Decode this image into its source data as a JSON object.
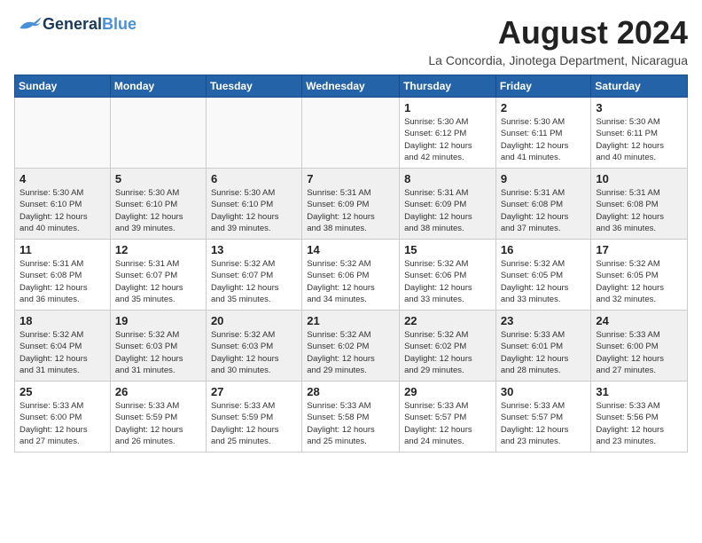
{
  "logo": {
    "part1": "General",
    "part2": "Blue"
  },
  "title": {
    "month_year": "August 2024",
    "location": "La Concordia, Jinotega Department, Nicaragua"
  },
  "weekdays": [
    "Sunday",
    "Monday",
    "Tuesday",
    "Wednesday",
    "Thursday",
    "Friday",
    "Saturday"
  ],
  "weeks": [
    [
      {
        "day": "",
        "info": ""
      },
      {
        "day": "",
        "info": ""
      },
      {
        "day": "",
        "info": ""
      },
      {
        "day": "",
        "info": ""
      },
      {
        "day": "1",
        "info": "Sunrise: 5:30 AM\nSunset: 6:12 PM\nDaylight: 12 hours\nand 42 minutes."
      },
      {
        "day": "2",
        "info": "Sunrise: 5:30 AM\nSunset: 6:11 PM\nDaylight: 12 hours\nand 41 minutes."
      },
      {
        "day": "3",
        "info": "Sunrise: 5:30 AM\nSunset: 6:11 PM\nDaylight: 12 hours\nand 40 minutes."
      }
    ],
    [
      {
        "day": "4",
        "info": "Sunrise: 5:30 AM\nSunset: 6:10 PM\nDaylight: 12 hours\nand 40 minutes."
      },
      {
        "day": "5",
        "info": "Sunrise: 5:30 AM\nSunset: 6:10 PM\nDaylight: 12 hours\nand 39 minutes."
      },
      {
        "day": "6",
        "info": "Sunrise: 5:30 AM\nSunset: 6:10 PM\nDaylight: 12 hours\nand 39 minutes."
      },
      {
        "day": "7",
        "info": "Sunrise: 5:31 AM\nSunset: 6:09 PM\nDaylight: 12 hours\nand 38 minutes."
      },
      {
        "day": "8",
        "info": "Sunrise: 5:31 AM\nSunset: 6:09 PM\nDaylight: 12 hours\nand 38 minutes."
      },
      {
        "day": "9",
        "info": "Sunrise: 5:31 AM\nSunset: 6:08 PM\nDaylight: 12 hours\nand 37 minutes."
      },
      {
        "day": "10",
        "info": "Sunrise: 5:31 AM\nSunset: 6:08 PM\nDaylight: 12 hours\nand 36 minutes."
      }
    ],
    [
      {
        "day": "11",
        "info": "Sunrise: 5:31 AM\nSunset: 6:08 PM\nDaylight: 12 hours\nand 36 minutes."
      },
      {
        "day": "12",
        "info": "Sunrise: 5:31 AM\nSunset: 6:07 PM\nDaylight: 12 hours\nand 35 minutes."
      },
      {
        "day": "13",
        "info": "Sunrise: 5:32 AM\nSunset: 6:07 PM\nDaylight: 12 hours\nand 35 minutes."
      },
      {
        "day": "14",
        "info": "Sunrise: 5:32 AM\nSunset: 6:06 PM\nDaylight: 12 hours\nand 34 minutes."
      },
      {
        "day": "15",
        "info": "Sunrise: 5:32 AM\nSunset: 6:06 PM\nDaylight: 12 hours\nand 33 minutes."
      },
      {
        "day": "16",
        "info": "Sunrise: 5:32 AM\nSunset: 6:05 PM\nDaylight: 12 hours\nand 33 minutes."
      },
      {
        "day": "17",
        "info": "Sunrise: 5:32 AM\nSunset: 6:05 PM\nDaylight: 12 hours\nand 32 minutes."
      }
    ],
    [
      {
        "day": "18",
        "info": "Sunrise: 5:32 AM\nSunset: 6:04 PM\nDaylight: 12 hours\nand 31 minutes."
      },
      {
        "day": "19",
        "info": "Sunrise: 5:32 AM\nSunset: 6:03 PM\nDaylight: 12 hours\nand 31 minutes."
      },
      {
        "day": "20",
        "info": "Sunrise: 5:32 AM\nSunset: 6:03 PM\nDaylight: 12 hours\nand 30 minutes."
      },
      {
        "day": "21",
        "info": "Sunrise: 5:32 AM\nSunset: 6:02 PM\nDaylight: 12 hours\nand 29 minutes."
      },
      {
        "day": "22",
        "info": "Sunrise: 5:32 AM\nSunset: 6:02 PM\nDaylight: 12 hours\nand 29 minutes."
      },
      {
        "day": "23",
        "info": "Sunrise: 5:33 AM\nSunset: 6:01 PM\nDaylight: 12 hours\nand 28 minutes."
      },
      {
        "day": "24",
        "info": "Sunrise: 5:33 AM\nSunset: 6:00 PM\nDaylight: 12 hours\nand 27 minutes."
      }
    ],
    [
      {
        "day": "25",
        "info": "Sunrise: 5:33 AM\nSunset: 6:00 PM\nDaylight: 12 hours\nand 27 minutes."
      },
      {
        "day": "26",
        "info": "Sunrise: 5:33 AM\nSunset: 5:59 PM\nDaylight: 12 hours\nand 26 minutes."
      },
      {
        "day": "27",
        "info": "Sunrise: 5:33 AM\nSunset: 5:59 PM\nDaylight: 12 hours\nand 25 minutes."
      },
      {
        "day": "28",
        "info": "Sunrise: 5:33 AM\nSunset: 5:58 PM\nDaylight: 12 hours\nand 25 minutes."
      },
      {
        "day": "29",
        "info": "Sunrise: 5:33 AM\nSunset: 5:57 PM\nDaylight: 12 hours\nand 24 minutes."
      },
      {
        "day": "30",
        "info": "Sunrise: 5:33 AM\nSunset: 5:57 PM\nDaylight: 12 hours\nand 23 minutes."
      },
      {
        "day": "31",
        "info": "Sunrise: 5:33 AM\nSunset: 5:56 PM\nDaylight: 12 hours\nand 23 minutes."
      }
    ]
  ]
}
